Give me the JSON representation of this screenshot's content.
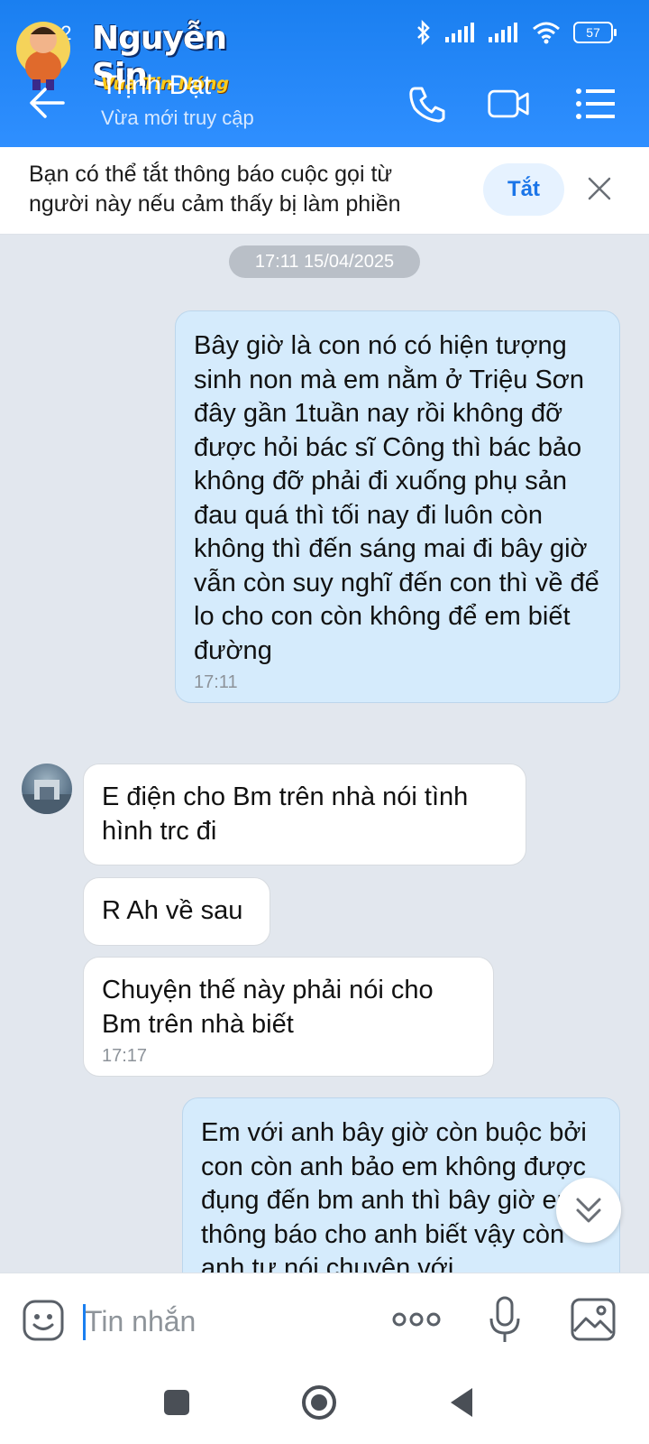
{
  "status_bar": {
    "time_partial": "22",
    "battery": "57"
  },
  "watermark": {
    "name": "Nguyễn Sin",
    "tagline": "Vua Tin Nóng"
  },
  "header": {
    "contact_name": "Trịnh Đạt",
    "contact_status": "Vừa mới truy cập",
    "icons": [
      "back-arrow-icon",
      "phone-icon",
      "video-call-icon",
      "menu-list-icon"
    ]
  },
  "banner": {
    "text": "Bạn có thể tắt thông báo cuộc gọi từ người này nếu cảm thấy bị làm phiền",
    "button_label": "Tắt"
  },
  "chat": {
    "date_divider": "17:11 15/04/2025",
    "messages": [
      {
        "direction": "sent",
        "text": "Bây giờ là con nó có hiện tượng sinh non mà em nằm ở Triệu Sơn đây gần 1tuần nay rồi không đỡ được hỏi bác sĩ Công thì bác bảo không đỡ phải đi xuống phụ sản đau quá thì tối nay đi luôn còn không thì đến sáng mai đi bây giờ vẫn còn suy nghĩ đến con thì về để lo cho con còn không để em biết đường",
        "time": "17:11"
      },
      {
        "direction": "received",
        "text": "E điện cho Bm trên nhà nói tình hình trc đi"
      },
      {
        "direction": "received",
        "text": "R Ah về sau"
      },
      {
        "direction": "received",
        "text": "Chuyện  thế này phải nói cho Bm trên nhà biết",
        "time": "17:17"
      },
      {
        "direction": "sent",
        "text": "Em với anh bây giờ còn buộc bởi con còn anh bảo em không được đụng đến bm anh thì bây giờ em thông báo cho anh biết vậy còn anh tự nói chuyện với"
      }
    ]
  },
  "input": {
    "placeholder": "Tin nhắn"
  },
  "colors": {
    "header": "#1a7ff0",
    "sent_bubble": "#d5ebfc",
    "received_bubble": "#ffffff",
    "background": "#e2e7ee"
  }
}
